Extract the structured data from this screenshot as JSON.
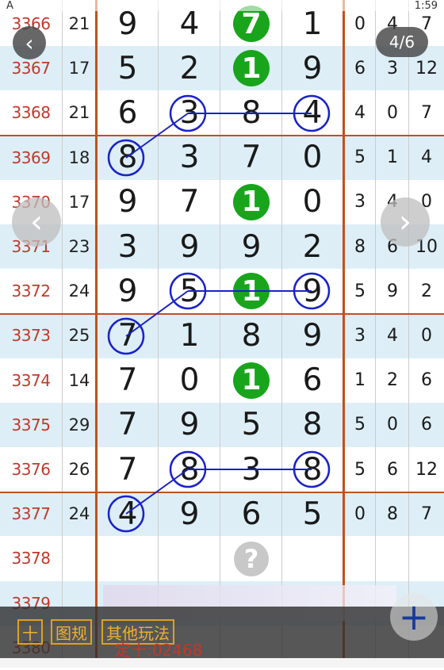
{
  "status_bar": {
    "left_icon": "A",
    "time": "1:59"
  },
  "nav": {
    "back_icon": "‹",
    "page_indicator": "4/6",
    "prev_icon": "‹",
    "next_icon": "›"
  },
  "rows": [
    {
      "issue": "3366",
      "sum": "21",
      "digits": [
        "9",
        "4",
        "7",
        "1"
      ],
      "ext": [
        "0",
        "4",
        "7"
      ]
    },
    {
      "issue": "3367",
      "sum": "17",
      "digits": [
        "5",
        "2",
        "1",
        "9"
      ],
      "ext": [
        "6",
        "3",
        "12"
      ]
    },
    {
      "issue": "3368",
      "sum": "21",
      "digits": [
        "6",
        "3",
        "8",
        "4"
      ],
      "ext": [
        "4",
        "0",
        "7"
      ]
    },
    {
      "issue": "3369",
      "sum": "18",
      "digits": [
        "8",
        "3",
        "7",
        "0"
      ],
      "ext": [
        "5",
        "1",
        "4"
      ]
    },
    {
      "issue": "3370",
      "sum": "17",
      "digits": [
        "9",
        "7",
        "1",
        "0"
      ],
      "ext": [
        "3",
        "4",
        "0"
      ]
    },
    {
      "issue": "3371",
      "sum": "23",
      "digits": [
        "3",
        "9",
        "9",
        "2"
      ],
      "ext": [
        "8",
        "6",
        "10"
      ]
    },
    {
      "issue": "3372",
      "sum": "24",
      "digits": [
        "9",
        "5",
        "1",
        "9"
      ],
      "ext": [
        "5",
        "9",
        "2"
      ]
    },
    {
      "issue": "3373",
      "sum": "25",
      "digits": [
        "7",
        "1",
        "8",
        "9"
      ],
      "ext": [
        "3",
        "4",
        "0"
      ]
    },
    {
      "issue": "3374",
      "sum": "14",
      "digits": [
        "7",
        "0",
        "1",
        "6"
      ],
      "ext": [
        "1",
        "2",
        "6"
      ]
    },
    {
      "issue": "3375",
      "sum": "29",
      "digits": [
        "7",
        "9",
        "5",
        "8"
      ],
      "ext": [
        "5",
        "0",
        "6"
      ]
    },
    {
      "issue": "3376",
      "sum": "26",
      "digits": [
        "7",
        "8",
        "3",
        "8"
      ],
      "ext": [
        "5",
        "6",
        "12"
      ]
    },
    {
      "issue": "3377",
      "sum": "24",
      "digits": [
        "4",
        "9",
        "6",
        "5"
      ],
      "ext": [
        "0",
        "8",
        "7"
      ]
    },
    {
      "issue": "3378",
      "sum": "",
      "digits": [
        "",
        "",
        "?",
        ""
      ],
      "ext": [
        "",
        "",
        ""
      ]
    },
    {
      "issue": "3379",
      "sum": "",
      "digits": [
        "",
        "",
        "",
        ""
      ],
      "ext": [
        "",
        "",
        ""
      ]
    },
    {
      "issue": "3380",
      "sum": "",
      "digits": [
        "",
        "",
        "",
        ""
      ],
      "ext": [
        "",
        "",
        ""
      ]
    }
  ],
  "bottom_toolbar": {
    "ten_label": "十",
    "chart_rules_label": "图规",
    "other_play_label": "其他玩法",
    "overlay_text": "定十:02468",
    "fab_icon": "+"
  },
  "colors": {
    "issue": "#c0392b",
    "row_alt": "#ddeef7",
    "row_white": "#ffffff",
    "divider": "#c0501f",
    "circle": "#1a22c8",
    "green_ball": "#18a51c",
    "toolbar_accent": "#e0a020"
  }
}
